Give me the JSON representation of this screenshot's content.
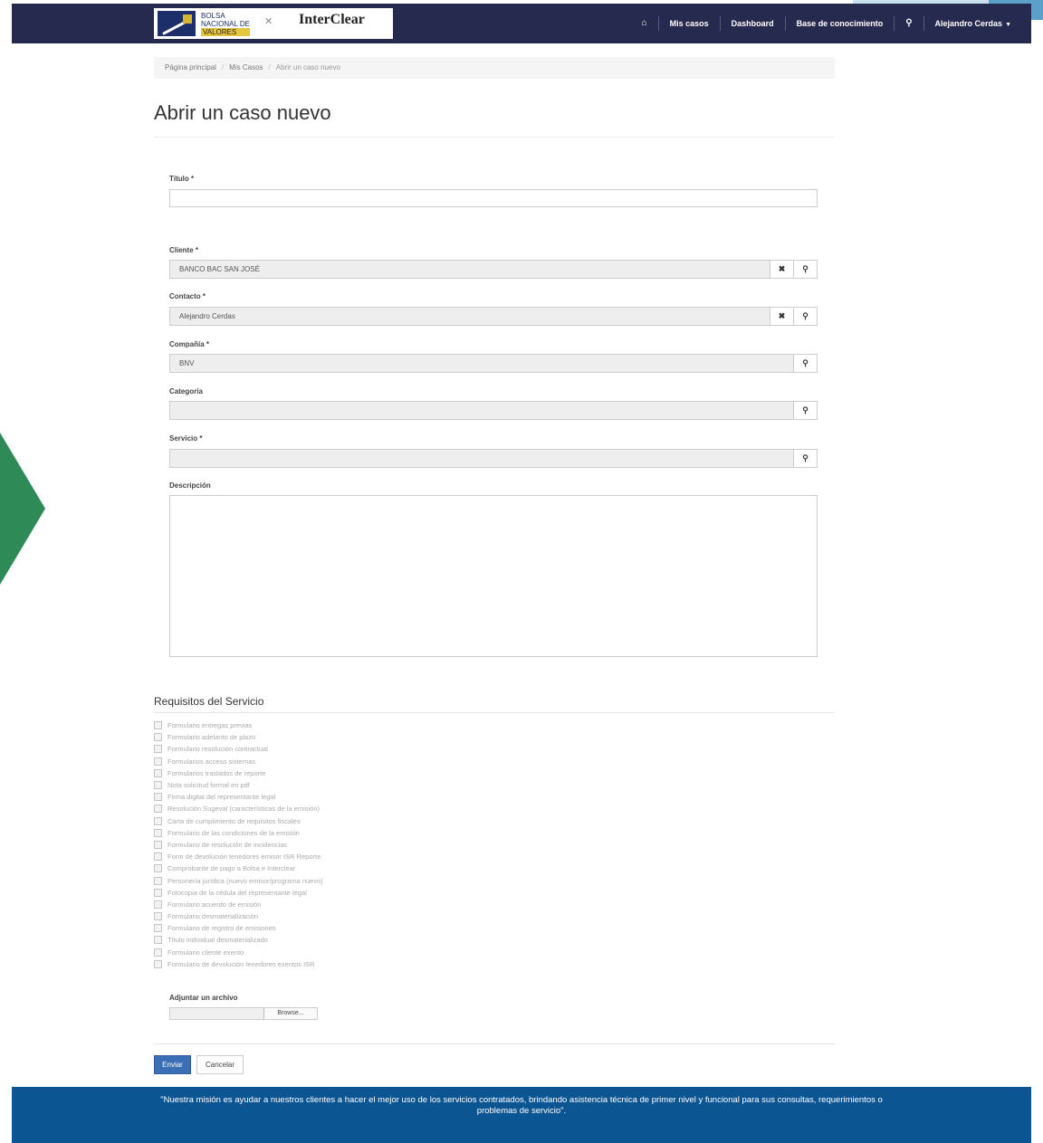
{
  "navbar": {
    "logo_bnv": [
      "BOLSA",
      "NACIONAL DE",
      "VALORES"
    ],
    "logo_interclear": "InterClear",
    "items": [
      {
        "label": "Mis casos"
      },
      {
        "label": "Dashboard"
      },
      {
        "label": "Base de conocimiento"
      }
    ],
    "user_label": "Alejandro Cerdas"
  },
  "breadcrumb": {
    "items": [
      "Página principal",
      "Mis Casos",
      "Abrir un caso nuevo"
    ]
  },
  "page": {
    "title": "Abrir un caso nuevo"
  },
  "form": {
    "titulo": {
      "label": "Título",
      "value": ""
    },
    "cliente": {
      "label": "Cliente",
      "value": "BANCO BAC SAN JOSÉ"
    },
    "contacto": {
      "label": "Contacto",
      "value": "Alejandro Cerdas"
    },
    "compania": {
      "label": "Compañía",
      "value": "BNV"
    },
    "categoria": {
      "label": "Categoría",
      "value": ""
    },
    "servicio": {
      "label": "Servicio",
      "value": ""
    },
    "descripcion": {
      "label": "Descripción",
      "value": ""
    },
    "required_mark": "*"
  },
  "requisitos": {
    "title": "Requisitos del Servicio",
    "items": [
      "Formulario entregas previas",
      "Formulario adelanto de plazo",
      "Formulario resolución contractual",
      "Formularios acceso sistemas",
      "Formularios traslados de reporte",
      "Nota solicitud formal en pdf",
      "Firma digital del representante legal",
      "Resolución Sugeval (características de la emisión)",
      "Carta de cumplimiento de requisitos fiscales",
      "Formulario de las condiciones de la emisión",
      "Formulario de resolución de incidencias",
      "Form de devolución tenedores emisor ISR Reporte",
      "Comprobante de pago a Bolsa e Interclear",
      "Personería jurídica (nuevo emisor/programa nuevo)",
      "Fotocopia de la cédula del representante legal",
      "Formulario acuerdo de emisión",
      "Formulario desmaterialización",
      "Formulario de registro de emisiones",
      "Título individual desmaterializado",
      "Formulario cliente exento",
      "Formulario de devolución tenedores exentos ISR"
    ]
  },
  "attach": {
    "label": "Adjuntar un archivo",
    "browse": "Browse..."
  },
  "buttons": {
    "submit": "Enviar",
    "cancel": "Cancelar"
  },
  "footer": {
    "text": "\"Nuestra misión es ayudar a nuestros clientes a hacer el mejor uso de los servicios contratados, brindando asistencia técnica de primer nivel y funcional para sus consultas, requerimientos o problemas de servicio\"."
  },
  "colors": {
    "navbar": "#262a4e",
    "footer": "#0c5593",
    "primary_button": "#3a6fb5",
    "accent_green": "#2e8b57"
  },
  "icons": {
    "home": "home-icon",
    "search": "search-icon",
    "clear": "clear-icon",
    "lookup": "search-icon",
    "caret": "caret-down-icon"
  }
}
